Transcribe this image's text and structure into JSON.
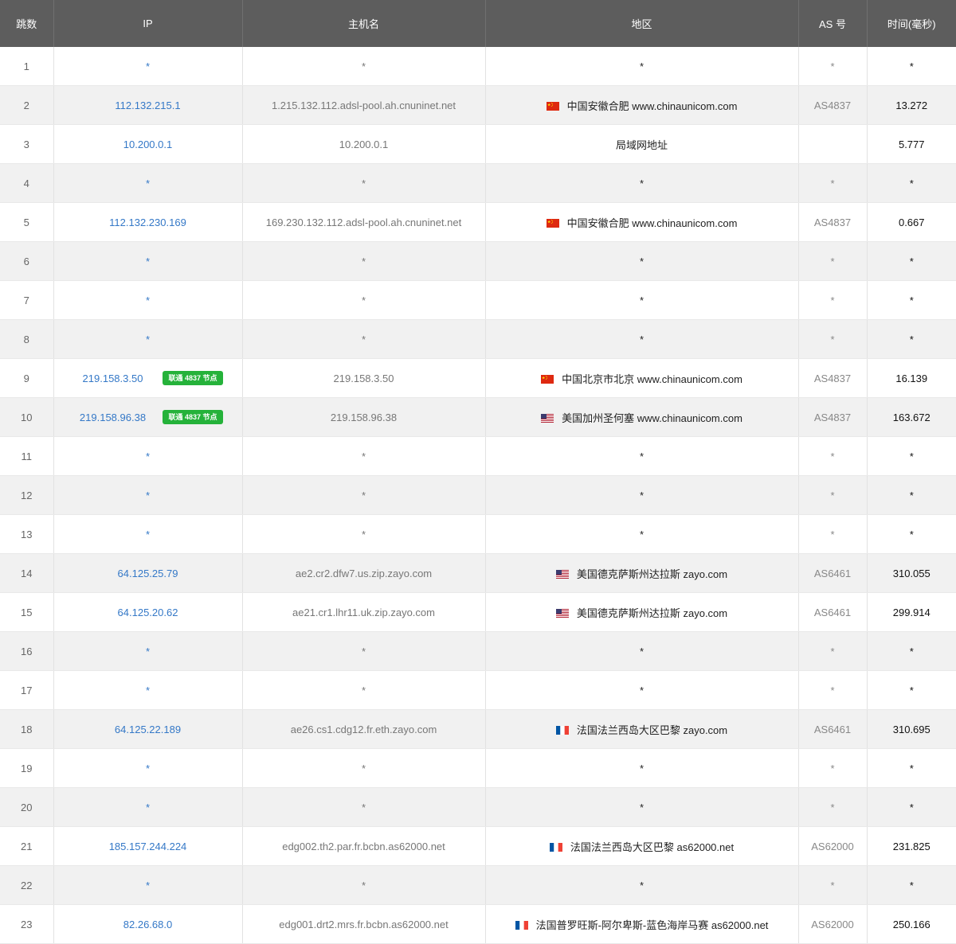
{
  "table": {
    "headers": {
      "hop": "跳数",
      "ip": "IP",
      "host": "主机名",
      "region": "地区",
      "as": "AS 号",
      "time": "时间(毫秒)"
    },
    "rows": [
      {
        "hop": "1",
        "ip": "*",
        "host": "*",
        "region": "*",
        "as": "*",
        "time": "*"
      },
      {
        "hop": "2",
        "ip": "112.132.215.1",
        "host": "1.215.132.112.adsl-pool.ah.cnuninet.net",
        "flag": "cn-flag-icon",
        "region": "中国安徽合肥 www.chinaunicom.com",
        "as": "AS4837",
        "time": "13.272"
      },
      {
        "hop": "3",
        "ip": "10.200.0.1",
        "host": "10.200.0.1",
        "region": "局域网地址",
        "as": "",
        "time": "5.777"
      },
      {
        "hop": "4",
        "ip": "*",
        "host": "*",
        "region": "*",
        "as": "*",
        "time": "*"
      },
      {
        "hop": "5",
        "ip": "112.132.230.169",
        "host": "169.230.132.112.adsl-pool.ah.cnuninet.net",
        "flag": "cn-flag-icon",
        "region": "中国安徽合肥 www.chinaunicom.com",
        "as": "AS4837",
        "time": "0.667"
      },
      {
        "hop": "6",
        "ip": "*",
        "host": "*",
        "region": "*",
        "as": "*",
        "time": "*"
      },
      {
        "hop": "7",
        "ip": "*",
        "host": "*",
        "region": "*",
        "as": "*",
        "time": "*"
      },
      {
        "hop": "8",
        "ip": "*",
        "host": "*",
        "region": "*",
        "as": "*",
        "time": "*"
      },
      {
        "hop": "9",
        "ip": "219.158.3.50",
        "badge": "联通 4837 节点",
        "host": "219.158.3.50",
        "flag": "cn-flag-icon",
        "region": "中国北京市北京 www.chinaunicom.com",
        "as": "AS4837",
        "time": "16.139"
      },
      {
        "hop": "10",
        "ip": "219.158.96.38",
        "badge": "联通 4837 节点",
        "host": "219.158.96.38",
        "flag": "us-flag-icon",
        "region": "美国加州圣何塞 www.chinaunicom.com",
        "as": "AS4837",
        "time": "163.672"
      },
      {
        "hop": "11",
        "ip": "*",
        "host": "*",
        "region": "*",
        "as": "*",
        "time": "*"
      },
      {
        "hop": "12",
        "ip": "*",
        "host": "*",
        "region": "*",
        "as": "*",
        "time": "*"
      },
      {
        "hop": "13",
        "ip": "*",
        "host": "*",
        "region": "*",
        "as": "*",
        "time": "*"
      },
      {
        "hop": "14",
        "ip": "64.125.25.79",
        "host": "ae2.cr2.dfw7.us.zip.zayo.com",
        "flag": "us-flag-icon",
        "region": "美国德克萨斯州达拉斯 zayo.com",
        "as": "AS6461",
        "time": "310.055"
      },
      {
        "hop": "15",
        "ip": "64.125.20.62",
        "host": "ae21.cr1.lhr11.uk.zip.zayo.com",
        "flag": "us-flag-icon",
        "region": "美国德克萨斯州达拉斯 zayo.com",
        "as": "AS6461",
        "time": "299.914"
      },
      {
        "hop": "16",
        "ip": "*",
        "host": "*",
        "region": "*",
        "as": "*",
        "time": "*"
      },
      {
        "hop": "17",
        "ip": "*",
        "host": "*",
        "region": "*",
        "as": "*",
        "time": "*"
      },
      {
        "hop": "18",
        "ip": "64.125.22.189",
        "host": "ae26.cs1.cdg12.fr.eth.zayo.com",
        "flag": "fr-flag-icon",
        "region": "法国法兰西岛大区巴黎 zayo.com",
        "as": "AS6461",
        "time": "310.695"
      },
      {
        "hop": "19",
        "ip": "*",
        "host": "*",
        "region": "*",
        "as": "*",
        "time": "*"
      },
      {
        "hop": "20",
        "ip": "*",
        "host": "*",
        "region": "*",
        "as": "*",
        "time": "*"
      },
      {
        "hop": "21",
        "ip": "185.157.244.224",
        "host": "edg002.th2.par.fr.bcbn.as62000.net",
        "flag": "fr-flag-icon",
        "region": "法国法兰西岛大区巴黎 as62000.net",
        "as": "AS62000",
        "time": "231.825"
      },
      {
        "hop": "22",
        "ip": "*",
        "host": "*",
        "region": "*",
        "as": "*",
        "time": "*"
      },
      {
        "hop": "23",
        "ip": "82.26.68.0",
        "host": "edg001.drt2.mrs.fr.bcbn.as62000.net",
        "flag": "fr-flag-icon",
        "region": "法国普罗旺斯-阿尔卑斯-蓝色海岸马赛 as62000.net",
        "as": "AS62000",
        "time": "250.166"
      }
    ]
  },
  "colors": {
    "header_bg": "#5d5d5d",
    "ip_link": "#3478c7",
    "badge_bg": "#25b23a",
    "row_alt_bg": "#f1f1f1"
  }
}
